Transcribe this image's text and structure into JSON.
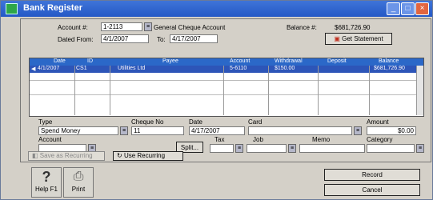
{
  "window": {
    "title": "Bank Register"
  },
  "account": {
    "label": "Account #:",
    "value": "1-2113",
    "name": "General Cheque Account"
  },
  "balance": {
    "label": "Balance #:",
    "value": "$681,726.90"
  },
  "dates": {
    "from_label": "Dated From:",
    "from_value": "4/1/2007",
    "to_label": "To:",
    "to_value": "4/17/2007"
  },
  "get_statement_label": "Get Statement",
  "grid": {
    "columns": [
      "Date",
      "ID",
      "Payee",
      "Account",
      "Withdrawal",
      "Deposit",
      "Balance"
    ],
    "row": {
      "date": "4/1/2007",
      "id": "CS1",
      "payee": "Utilities Ltd",
      "account": "5-6110",
      "withdrawal": "$150.00",
      "deposit": "",
      "balance": "$681,726.90"
    }
  },
  "form": {
    "type_label": "Type",
    "type_value": "Spend Money",
    "cheque_label": "Cheque No",
    "cheque_value": "11",
    "date_label": "Date",
    "date_value": "4/17/2007",
    "card_label": "Card",
    "card_value": "",
    "amount_label": "Amount",
    "amount_value": "$0.00",
    "account_label": "Account",
    "account_value": "",
    "tax_label": "Tax",
    "tax_value": "",
    "job_label": "Job",
    "job_value": "",
    "memo_label": "Memo",
    "memo_value": "",
    "category_label": "Category",
    "category_value": "",
    "split_label": "Split..."
  },
  "recurring": {
    "save_label": "Save as Recurring",
    "use_label": "Use Recurring"
  },
  "bottom": {
    "help_label": "Help F1",
    "print_label": "Print",
    "record_label": "Record",
    "cancel_label": "Cancel"
  },
  "colors": {
    "titlebar": "#2458c6",
    "selection": "#2d55b8",
    "header": "#2b68c8"
  }
}
